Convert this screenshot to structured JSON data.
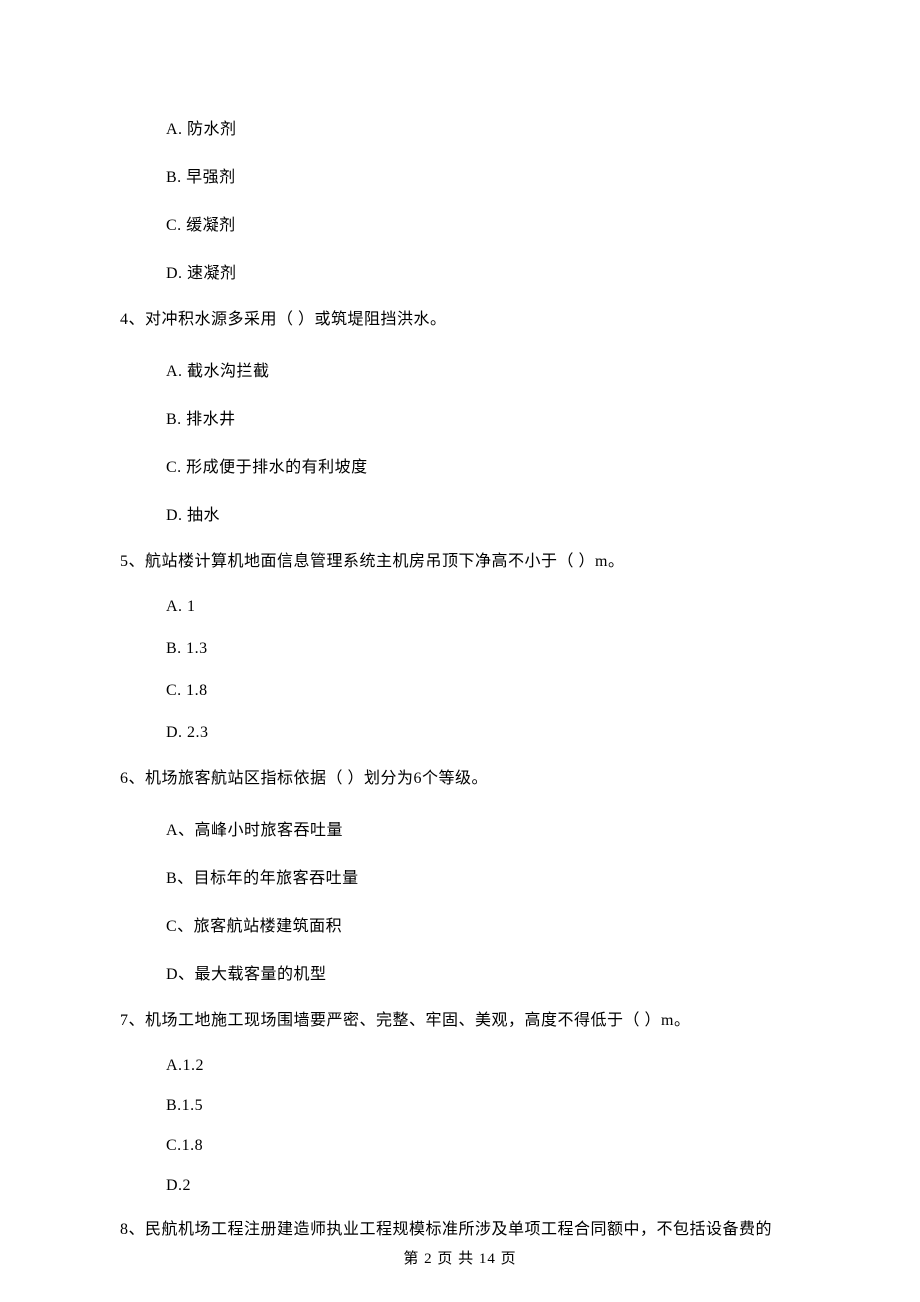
{
  "q3_options": {
    "a": "A. 防水剂",
    "b": "B. 早强剂",
    "c": "C. 缓凝剂",
    "d": "D. 速凝剂"
  },
  "q4": {
    "stem": "4、对冲积水源多采用（   ）或筑堤阻挡洪水。",
    "a": "A. 截水沟拦截",
    "b": "B. 排水井",
    "c": "C. 形成便于排水的有利坡度",
    "d": "D. 抽水"
  },
  "q5": {
    "stem": "5、航站楼计算机地面信息管理系统主机房吊顶下净高不小于（   ）m。",
    "a": "A. 1",
    "b": "B. 1.3",
    "c": "C. 1.8",
    "d": "D. 2.3"
  },
  "q6": {
    "stem": "6、机场旅客航站区指标依据（   ）划分为6个等级。",
    "a": "A、高峰小时旅客吞吐量",
    "b": "B、目标年的年旅客吞吐量",
    "c": "C、旅客航站楼建筑面积",
    "d": "D、最大载客量的机型"
  },
  "q7": {
    "stem": "7、机场工地施工现场围墙要严密、完整、牢固、美观，高度不得低于（   ）m。",
    "a": "A.1.2",
    "b": "B.1.5",
    "c": "C.1.8",
    "d": "D.2"
  },
  "q8": {
    "stem": "8、民航机场工程注册建造师执业工程规模标准所涉及单项工程合同额中，不包括设备费的"
  },
  "footer": "第 2 页 共 14 页"
}
